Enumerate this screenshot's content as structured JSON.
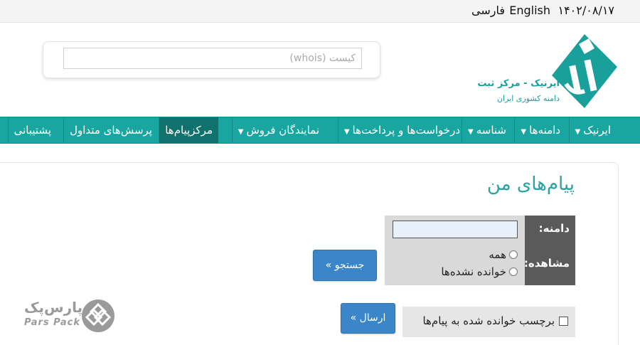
{
  "topbar": {
    "date": "۱۴۰۲/۰۸/۱۷",
    "lang_english": "English",
    "lang_farsi": "فارسی"
  },
  "search": {
    "placeholder": "کیست (whois)"
  },
  "logo": {
    "brand": "ایرنیک - مرکز ثبت",
    "subtitle": "دامنه کشوری ایران"
  },
  "nav": {
    "items": [
      {
        "label": "ایرنیک",
        "dropdown": true
      },
      {
        "label": "دامنه‌ها",
        "dropdown": true
      },
      {
        "label": "شناسه",
        "dropdown": true
      },
      {
        "label": "درخواست‌ها و پرداخت‌ها",
        "dropdown": true
      },
      {
        "label": "نمایندگان فروش",
        "dropdown": true
      },
      {
        "label": "مرکزپیام‌ها",
        "dropdown": false,
        "active": true
      },
      {
        "label": "پرسش‌های متداول",
        "dropdown": false
      },
      {
        "label": "پشتیبانی",
        "dropdown": false
      }
    ]
  },
  "main": {
    "title": "پیام‌های من",
    "domain_label": "دامنه:",
    "view_label": "مشاهده:",
    "view_options": [
      "همه",
      "خوانده نشده‌ها"
    ],
    "search_button": "جستجو »",
    "mark_read_label": "برچسب خوانده شده به پیام‌ها",
    "send_button": "ارسال »"
  },
  "watermark": {
    "fa": "پارس‌پک",
    "en": "Pars Pack"
  },
  "colors": {
    "nav_bg": "#1aa6a0",
    "nav_active": "#10716d",
    "title": "#2aa3a1",
    "button": "#3a86c8",
    "label_bg": "#5a5a5a",
    "field_bg": "#d9d9d9"
  }
}
